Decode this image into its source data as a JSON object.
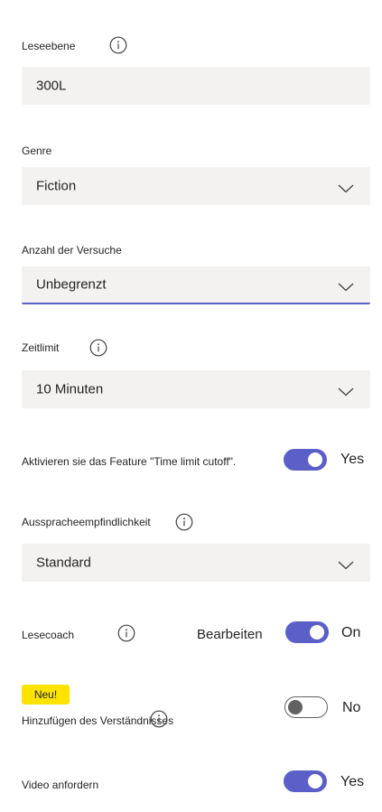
{
  "reading_level": {
    "label": "Leseebene",
    "value": "300L"
  },
  "genre": {
    "label": "Genre",
    "value": "Fiction"
  },
  "attempts": {
    "label": "Anzahl der Versuche",
    "value": "Unbegrenzt"
  },
  "time_limit": {
    "label": "Zeitlimit",
    "value": "10 Minuten"
  },
  "time_limit_cutoff": {
    "label": "Aktivieren sie das Feature \"Time limit cutoff\".",
    "state_text": "Yes",
    "enabled": true
  },
  "pronunciation_sensitivity": {
    "label": "Ausspracheempfindlichkeit",
    "value": "Standard"
  },
  "reading_coach": {
    "label": "Lesecoach",
    "edit_label": "Bearbeiten",
    "state_text": "On",
    "enabled": true
  },
  "comprehension": {
    "badge": "Neu!",
    "label": "Hinzufügen des Verständnisses",
    "state_text": "No",
    "enabled": false
  },
  "require_video": {
    "label": "Video anfordern",
    "state_text": "Yes",
    "enabled": true
  },
  "colors": {
    "accent": "#5b5fc7",
    "field_bg": "#f3f2f1",
    "badge": "#fde300"
  },
  "icons": {
    "info": "info-icon",
    "dropdown": "chevron-down-icon"
  }
}
